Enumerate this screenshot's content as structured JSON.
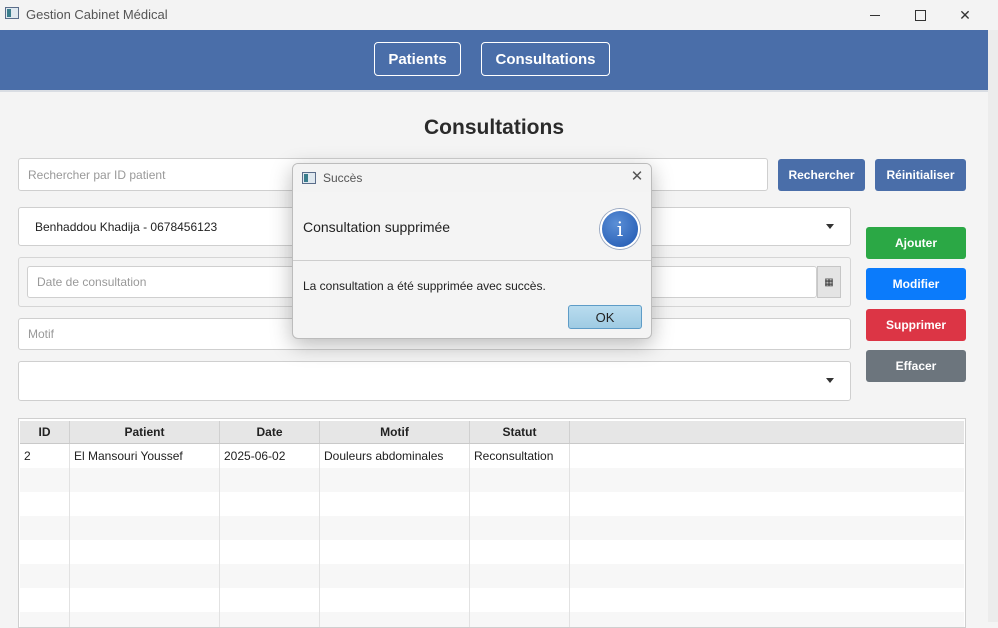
{
  "window": {
    "title": "Gestion Cabinet Médical",
    "controls": {
      "minimize": "minimize-icon",
      "maximize": "maximize-icon",
      "close": "close-icon"
    }
  },
  "nav": {
    "patients": "Patients",
    "consultations": "Consultations"
  },
  "page": {
    "title": "Consultations"
  },
  "search": {
    "placeholder": "Rechercher par ID patient",
    "search_button": "Rechercher",
    "reset_button": "Réinitialiser"
  },
  "form": {
    "patient_selected": "Benhaddou Khadija - 0678456123",
    "date_placeholder": "Date de consultation",
    "motif_placeholder": "Motif",
    "status_selected": ""
  },
  "actions": {
    "add": "Ajouter",
    "edit": "Modifier",
    "delete": "Supprimer",
    "clear": "Effacer"
  },
  "table": {
    "columns": [
      "ID",
      "Patient",
      "Date",
      "Motif",
      "Statut"
    ],
    "rows": [
      {
        "id": "2",
        "patient": "El Mansouri Youssef",
        "date": "2025-06-02",
        "motif": "Douleurs abdominales",
        "statut": "Reconsultation"
      }
    ]
  },
  "dialog": {
    "title": "Succès",
    "header": "Consultation supprimée",
    "content": "La consultation a été supprimée avec succès.",
    "ok": "OK",
    "icon": "info-icon",
    "icon_glyph": "i"
  },
  "colors": {
    "primary": "#4a6ea9",
    "success": "#2ba845",
    "info": "#0b7bfb",
    "danger": "#dc3545",
    "secondary": "#6c757d"
  }
}
